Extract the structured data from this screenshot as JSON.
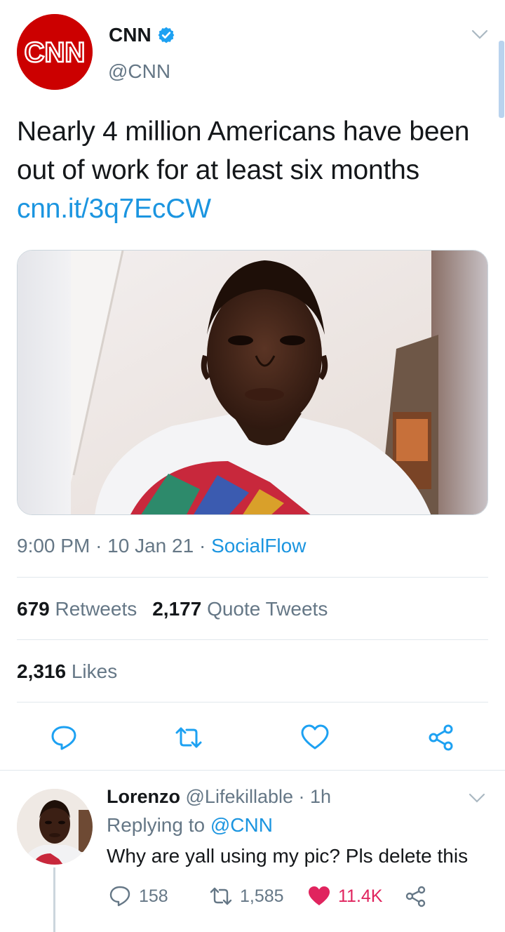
{
  "tweet": {
    "author_name": "CNN",
    "author_handle": "@CNN",
    "avatar_logo": "CNN",
    "verified_icon": "verified-badge-icon",
    "text": "Nearly 4 million Americans have been out of work for at least six months",
    "link": "cnn.it/3q7EcCW",
    "time": "9:00 PM",
    "date": "10 Jan 21",
    "separator": "·",
    "source": "SocialFlow",
    "retweets_count": "679",
    "retweets_label": "Retweets",
    "quotes_count": "2,177",
    "quotes_label": "Quote Tweets",
    "likes_count": "2,316",
    "likes_label": "Likes",
    "actions": [
      "reply-icon",
      "retweet-icon",
      "like-icon",
      "share-icon"
    ]
  },
  "reply": {
    "name": "Lorenzo",
    "handle": "@Lifekillable",
    "separator": "·",
    "time": "1h",
    "replying_prefix": "Replying to",
    "replying_to": "@CNN",
    "text": "Why are yall using my pic? Pls delete this",
    "reply_count": "158",
    "retweet_count": "1,585",
    "like_count": "11.4K",
    "like_color": "#e0245e"
  },
  "colors": {
    "link": "#1b95e0",
    "muted": "#657786",
    "cnn_red": "#cc0000"
  }
}
